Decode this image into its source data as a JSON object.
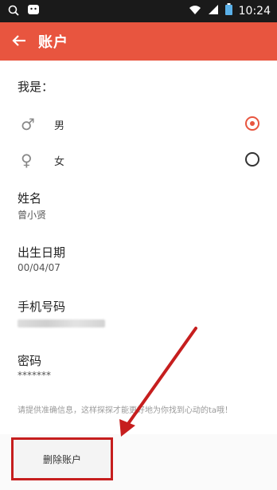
{
  "status": {
    "time": "10:24"
  },
  "appbar": {
    "title": "账户"
  },
  "gender": {
    "label": "我是：",
    "male": "男",
    "female": "女",
    "selected": "male"
  },
  "name": {
    "label": "姓名",
    "value": "曾小贤"
  },
  "birth": {
    "label": "出生日期",
    "value": "00/04/07"
  },
  "phone": {
    "label": "手机号码"
  },
  "password": {
    "label": "密码",
    "value": "*******"
  },
  "notice": "请提供准确信息，这样探探才能更好地为你找到心动的ta哦！",
  "delete_button": "删除账户",
  "colors": {
    "accent": "#e8553f",
    "annotation": "#c61e1e"
  }
}
